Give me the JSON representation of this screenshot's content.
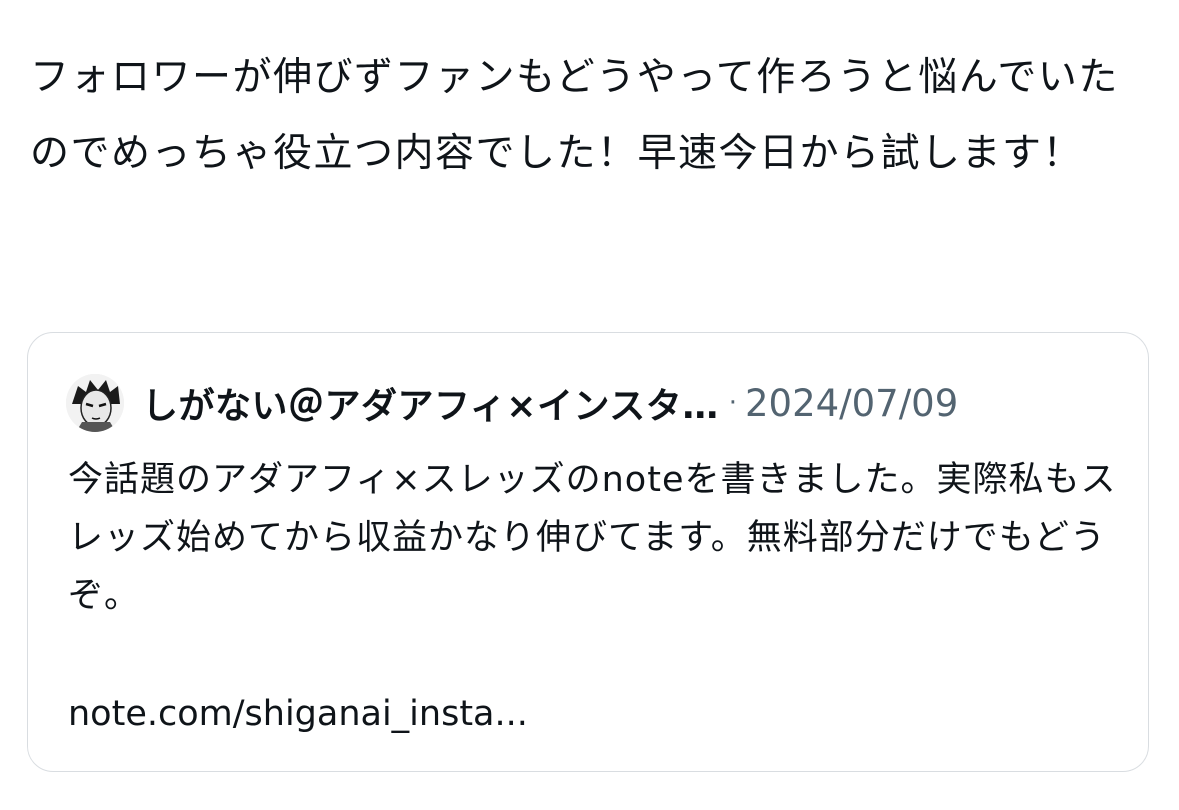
{
  "post": {
    "text": "フォロワーが伸びずファンもどうやって作ろうと悩んでいたのでめっちゃ役立つ内容でした！早速今日から試します！"
  },
  "quoted_post": {
    "avatar_icon": "manga-character-avatar",
    "author_name": "しがない＠アダアフィ×インスタ…",
    "separator": "·",
    "date": "2024/07/09",
    "body": "今話題のアダアフィ×スレッズのnoteを書きました。実際私もスレッズ始めてから収益かなり伸びてます。無料部分だけでもどうぞ。",
    "link_text": "note.com/shiganai_insta..."
  }
}
